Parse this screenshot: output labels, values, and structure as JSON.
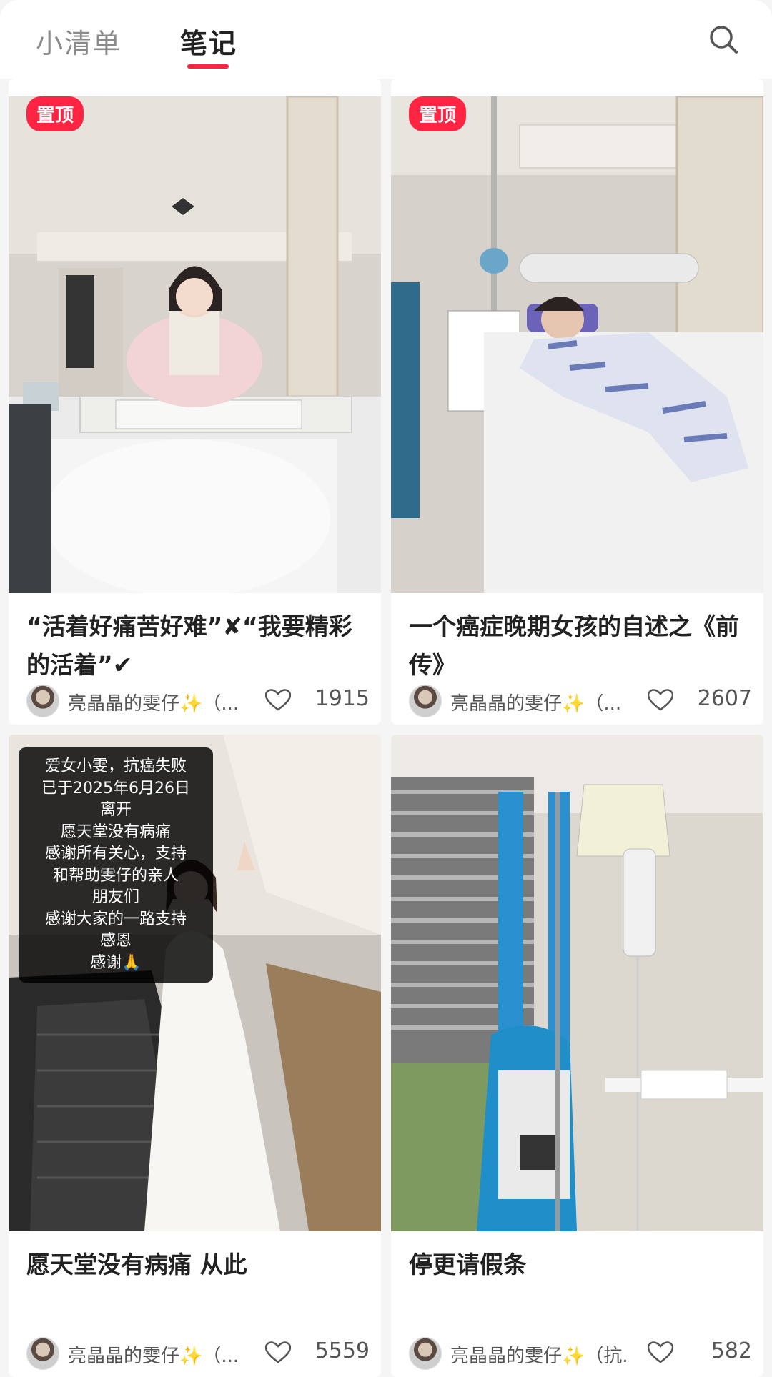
{
  "tabs": [
    {
      "label": "小清单",
      "active": false
    },
    {
      "label": "笔记",
      "active": true
    }
  ],
  "accent_color": "#ff2442",
  "search_icon": "search-icon",
  "notes": [
    {
      "title": "“活着好痛苦好难”✘“我要精彩的活着”✔",
      "pinned": true,
      "pin_label": "置顶",
      "author": "亮晶晶的雯仔✨（...",
      "likes": "1915"
    },
    {
      "title": "一个癌症晚期女孩的自述之《前传》",
      "pinned": true,
      "pin_label": "置顶",
      "author": "亮晶晶的雯仔✨（...",
      "likes": "2607"
    },
    {
      "title": "愿天堂没有病痛 从此",
      "pinned": false,
      "author": "亮晶晶的雯仔✨（...",
      "likes": "5559",
      "overlay_lines": [
        "爱女小雯，抗癌失败",
        "已于2025年6月26日",
        "离开",
        "愿天堂没有病痛",
        "感谢所有关心，支持",
        "和帮助雯仔的亲人",
        "朋友们",
        "感谢大家的一路支持",
        "感恩",
        "感谢🙏"
      ]
    },
    {
      "title": "停更请假条",
      "pinned": false,
      "author": "亮晶晶的雯仔✨（抗...",
      "likes": "582"
    }
  ]
}
